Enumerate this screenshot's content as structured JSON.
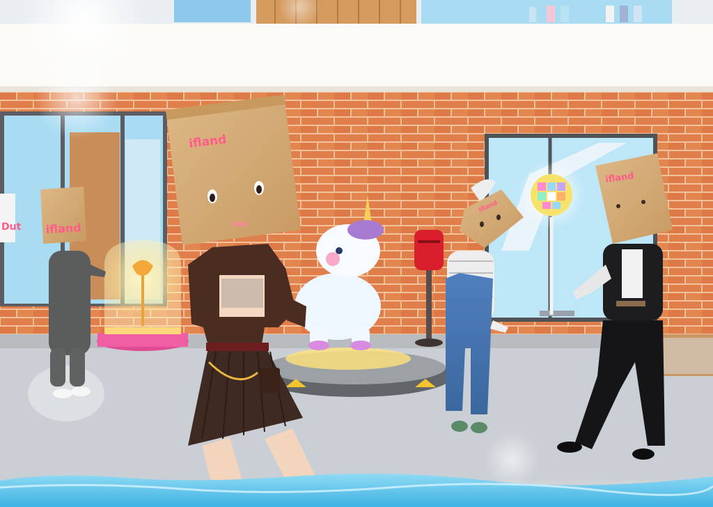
{
  "scene": {
    "description_type": "3d-metaverse-plaza",
    "brand_text": "ifland",
    "bag_labels": [
      "ifland",
      "ifland",
      "ifland",
      "ifland"
    ],
    "partial_sign_text": "Dut"
  },
  "colors": {
    "brick": "#e07f4c",
    "mortar": "#f2c39a",
    "sky_window": "#a9dcf3",
    "paper_bag": "#d5ad78",
    "brand_pink": "#ff5c8a",
    "pool_water": "#5fc4ea",
    "ground": "#c9cfd4",
    "mailbox_red": "#d91f2b"
  },
  "icons": [
    "paper-bag-icon",
    "unicorn-plush-icon",
    "rose-dome-icon",
    "mailbox-icon",
    "disco-ball-icon",
    "light-flare-icon"
  ]
}
